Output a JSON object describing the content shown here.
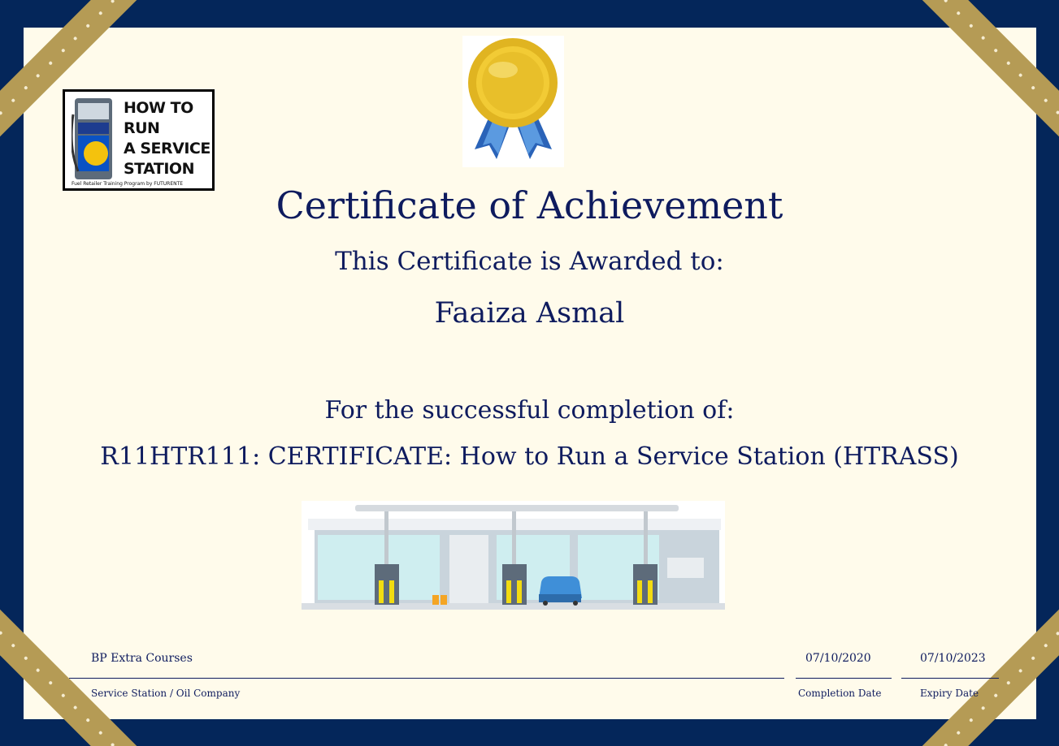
{
  "logo": {
    "lines": [
      "HOW TO",
      "RUN",
      "A SERVICE",
      "STATION"
    ],
    "subtitle": "Fuel Retailer Training Program by FUTURENTE"
  },
  "certificate": {
    "title": "Certificate of Achievement",
    "awarded_text": "This Certificate is Awarded to:",
    "recipient": "Faaiza Asmal",
    "completion_text": "For the successful completion of:",
    "course": "R11HTR111: CERTIFICATE: How to Run a Service Station (HTRASS)"
  },
  "footer": {
    "issuer": "BP Extra Courses",
    "issuer_label": "Service Station / Oil Company",
    "completion_date": "07/10/2020",
    "completion_label": "Completion Date",
    "expiry_date": "07/10/2023",
    "expiry_label": "Expiry Date"
  },
  "colors": {
    "border": "#04265a",
    "paper": "#fffbeb",
    "text": "#0e1b5e",
    "gold": "#b59b55"
  }
}
